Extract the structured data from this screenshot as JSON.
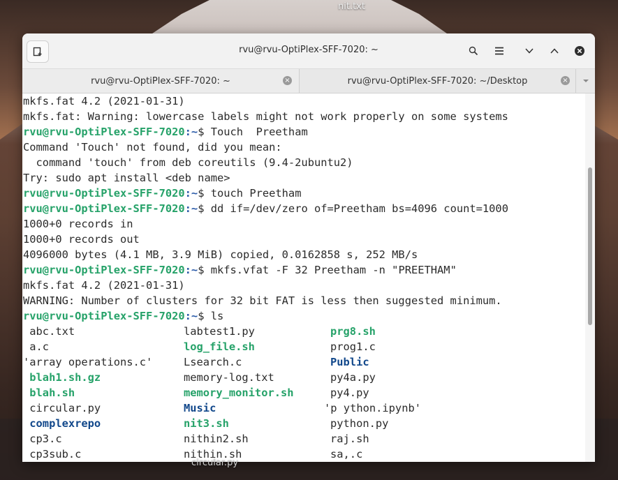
{
  "desktop": {
    "top_label": "nit.txt",
    "bottom_label": "circular.py"
  },
  "window": {
    "title": "rvu@rvu-OptiPlex-SFF-7020: ~",
    "tabs": [
      {
        "label": "rvu@rvu-OptiPlex-SFF-7020: ~"
      },
      {
        "label": "rvu@rvu-OptiPlex-SFF-7020: ~/Desktop"
      }
    ]
  },
  "terminal": {
    "lines": [
      {
        "text": "mkfs.fat 4.2 (2021-01-31)"
      },
      {
        "text": "mkfs.fat: Warning: lowercase labels might not work properly on some systems"
      },
      {
        "user": "rvu@rvu-OptiPlex-SFF-7020",
        "path": ":~",
        "cmd": "$ Touch  Preetham"
      },
      {
        "text": "Command 'Touch' not found, did you mean:"
      },
      {
        "text": "  command 'touch' from deb coreutils (9.4-2ubuntu2)"
      },
      {
        "text": "Try: sudo apt install <deb name>"
      },
      {
        "user": "rvu@rvu-OptiPlex-SFF-7020",
        "path": ":~",
        "cmd": "$ touch Preetham"
      },
      {
        "user": "rvu@rvu-OptiPlex-SFF-7020",
        "path": ":~",
        "cmd": "$ dd if=/dev/zero of=Preetham bs=4096 count=1000"
      },
      {
        "text": "1000+0 records in"
      },
      {
        "text": "1000+0 records out"
      },
      {
        "text": "4096000 bytes (4.1 MB, 3.9 MiB) copied, 0.0162858 s, 252 MB/s"
      },
      {
        "user": "rvu@rvu-OptiPlex-SFF-7020",
        "path": ":~",
        "cmd": "$ mkfs.vfat -F 32 Preetham -n \"PREETHAM\""
      },
      {
        "text": "mkfs.fat 4.2 (2021-01-31)"
      },
      {
        "text": "WARNING: Number of clusters for 32 bit FAT is less then suggested minimum."
      },
      {
        "user": "rvu@rvu-OptiPlex-SFF-7020",
        "path": ":~",
        "cmd": "$ ls"
      }
    ],
    "ls_rows": [
      [
        {
          "t": " abc.txt",
          "k": ""
        },
        {
          "t": "labtest1.py",
          "k": ""
        },
        {
          "t": "prg8.sh",
          "k": "exe"
        }
      ],
      [
        {
          "t": " a.c",
          "k": ""
        },
        {
          "t": "log_file.sh",
          "k": "exe"
        },
        {
          "t": "prog1.c",
          "k": ""
        }
      ],
      [
        {
          "t": "'array operations.c'",
          "k": ""
        },
        {
          "t": "Lsearch.c",
          "k": ""
        },
        {
          "t": "Public",
          "k": "dir"
        }
      ],
      [
        {
          "t": " blah1.sh.gz",
          "k": "exe"
        },
        {
          "t": "memory-log.txt",
          "k": ""
        },
        {
          "t": "py4a.py",
          "k": ""
        }
      ],
      [
        {
          "t": " blah.sh",
          "k": "exe"
        },
        {
          "t": "memory_monitor.sh",
          "k": "exe"
        },
        {
          "t": "py4.py",
          "k": ""
        }
      ],
      [
        {
          "t": " circular.py",
          "k": ""
        },
        {
          "t": "Music",
          "k": "dir"
        },
        {
          "t": "'p ython.ipynb'",
          "k": ""
        }
      ],
      [
        {
          "t": " complexrepo",
          "k": "dir"
        },
        {
          "t": "nit3.sh",
          "k": "exe"
        },
        {
          "t": "python.py",
          "k": ""
        }
      ],
      [
        {
          "t": " cp3.c",
          "k": ""
        },
        {
          "t": "nithin2.sh",
          "k": ""
        },
        {
          "t": "raj.sh",
          "k": ""
        }
      ],
      [
        {
          "t": " cp3sub.c",
          "k": ""
        },
        {
          "t": "nithin.sh",
          "k": ""
        },
        {
          "t": "sa,.c",
          "k": ""
        }
      ]
    ]
  },
  "colors": {
    "prompt_user": "#26a269",
    "prompt_path": "#2a5aa8",
    "exe": "#26a269",
    "dir": "#12488b"
  },
  "icons": [
    "new-tab-icon",
    "search-icon",
    "menu-icon",
    "minimize-icon",
    "maximize-icon",
    "close-icon",
    "tab-close-icon",
    "tabs-dropdown-icon"
  ]
}
